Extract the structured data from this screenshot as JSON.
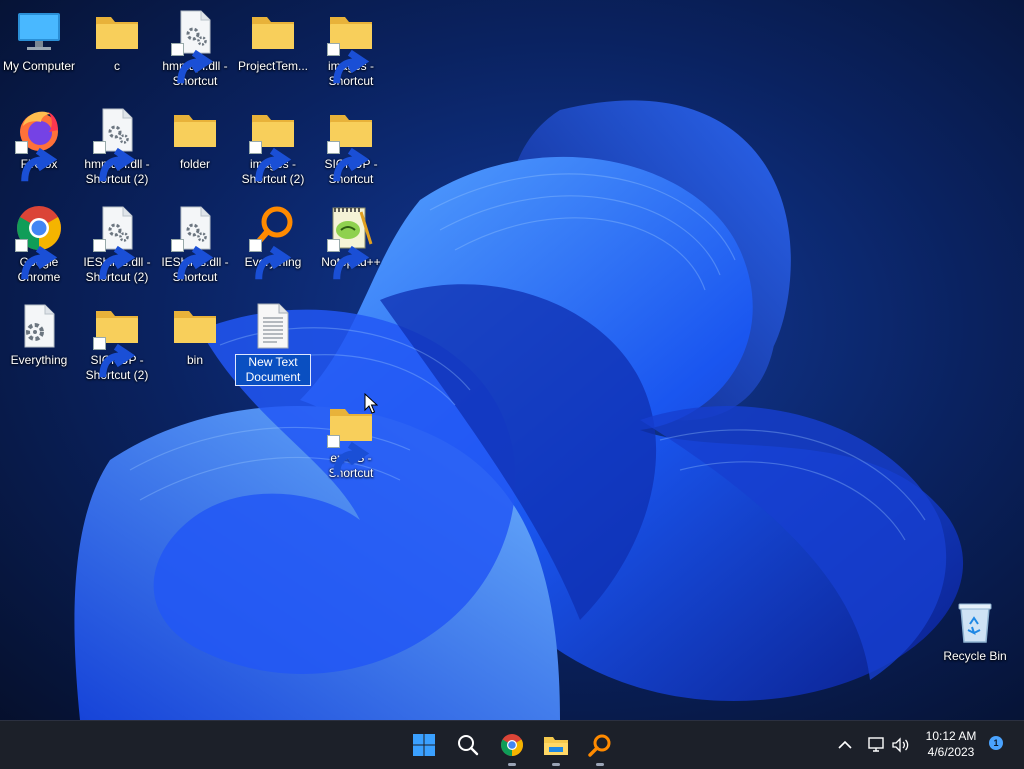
{
  "desktop": {
    "icons": [
      {
        "label": "My Computer",
        "icon": "computer-icon",
        "shortcut": false
      },
      {
        "label": "c",
        "icon": "folder-icon",
        "shortcut": false
      },
      {
        "label": "hmmapi.dll - Shortcut",
        "icon": "dll-file-icon",
        "shortcut": true
      },
      {
        "label": "ProjectTem...",
        "icon": "folder-icon",
        "shortcut": false
      },
      {
        "label": "images - Shortcut",
        "icon": "folder-icon",
        "shortcut": true
      },
      {
        "label": "Firefox",
        "icon": "firefox-icon",
        "shortcut": true
      },
      {
        "label": "hmmapi.dll - Shortcut (2)",
        "icon": "dll-file-icon",
        "shortcut": true
      },
      {
        "label": "folder",
        "icon": "folder-icon",
        "shortcut": false
      },
      {
        "label": "images - Shortcut (2)",
        "icon": "folder-icon",
        "shortcut": true
      },
      {
        "label": "SIGNUP - Shortcut",
        "icon": "folder-icon",
        "shortcut": true
      },
      {
        "label": "Google Chrome",
        "icon": "chrome-icon",
        "shortcut": true
      },
      {
        "label": "IEShims.dll - Shortcut (2)",
        "icon": "dll-file-icon",
        "shortcut": true
      },
      {
        "label": "IEShims.dll - Shortcut",
        "icon": "dll-file-icon",
        "shortcut": true
      },
      {
        "label": "Everything",
        "icon": "everything-icon",
        "shortcut": true
      },
      {
        "label": "Notepad++",
        "icon": "notepadpp-icon",
        "shortcut": true
      },
      {
        "label": "Everything",
        "icon": "gear-file-icon",
        "shortcut": false
      },
      {
        "label": "SIGNUP - Shortcut (2)",
        "icon": "folder-icon",
        "shortcut": true
      },
      {
        "label": "bin",
        "icon": "folder-icon",
        "shortcut": false
      },
      {
        "label": "New Text Document",
        "icon": "text-file-icon",
        "shortcut": false,
        "selected": true
      },
      {
        "label": "en-US - Shortcut",
        "icon": "folder-icon",
        "shortcut": true
      }
    ],
    "recycle_bin": {
      "label": "Recycle Bin",
      "icon": "recycle-bin-icon"
    }
  },
  "taskbar": {
    "apps": [
      {
        "name": "Start",
        "icon": "windows-start-icon"
      },
      {
        "name": "Search",
        "icon": "search-icon"
      },
      {
        "name": "Google Chrome",
        "icon": "chrome-icon"
      },
      {
        "name": "File Explorer",
        "icon": "file-explorer-icon"
      },
      {
        "name": "Everything",
        "icon": "everything-icon"
      }
    ],
    "tray": {
      "icons": [
        "chevron-up-icon",
        "network-icon",
        "volume-icon"
      ],
      "time": "10:12 AM",
      "date": "4/6/2023",
      "notification_count": "1"
    }
  },
  "colors": {
    "accent": "#0a4fc1",
    "taskbar": "#1c2029",
    "folder": "#f5c84c"
  }
}
